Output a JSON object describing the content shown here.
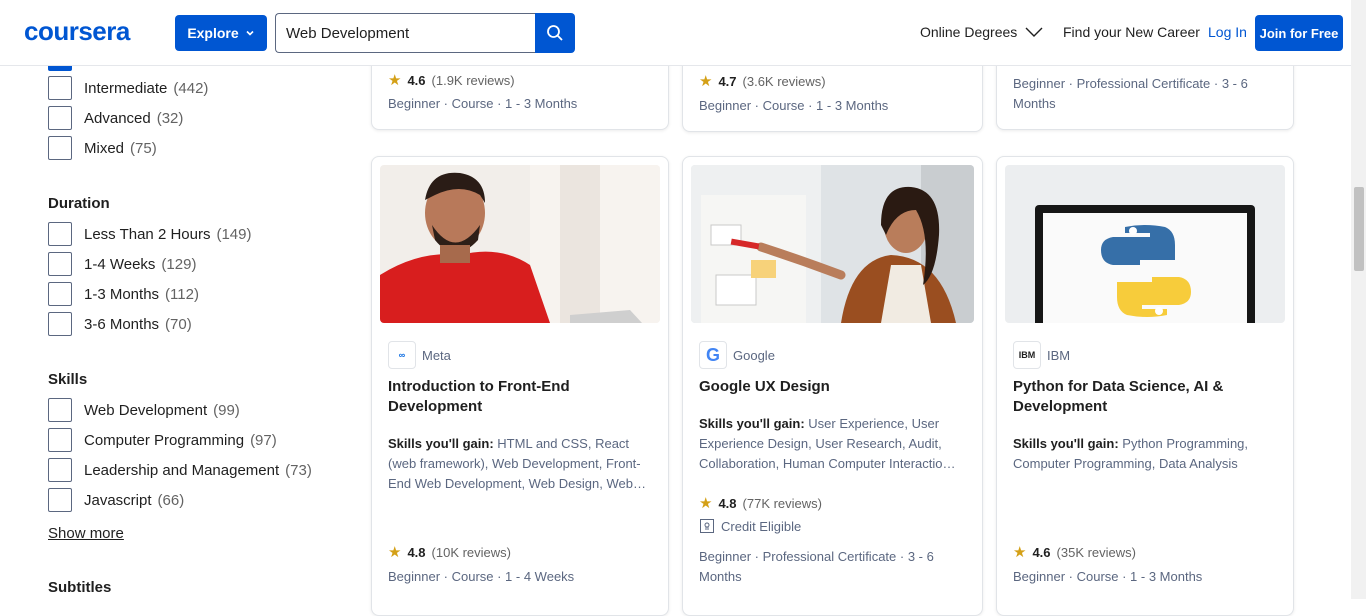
{
  "header": {
    "logo": "coursera",
    "explore_label": "Explore",
    "search_value": "Web Development",
    "nav_online": "Online Degrees",
    "nav_career": "Find your New Career",
    "nav_login": "Log In",
    "join_label": "Join for Free"
  },
  "sidebar": {
    "level_items": [
      {
        "label": "Intermediate",
        "count": "(442)"
      },
      {
        "label": "Advanced",
        "count": "(32)"
      },
      {
        "label": "Mixed",
        "count": "(75)"
      }
    ],
    "duration_heading": "Duration",
    "duration_items": [
      {
        "label": "Less Than 2 Hours",
        "count": "(149)"
      },
      {
        "label": "1-4 Weeks",
        "count": "(129)"
      },
      {
        "label": "1-3 Months",
        "count": "(112)"
      },
      {
        "label": "3-6 Months",
        "count": "(70)"
      }
    ],
    "skills_heading": "Skills",
    "skills_items": [
      {
        "label": "Web Development",
        "count": "(99)"
      },
      {
        "label": "Computer Programming",
        "count": "(97)"
      },
      {
        "label": "Leadership and Management",
        "count": "(73)"
      },
      {
        "label": "Javascript",
        "count": "(66)"
      }
    ],
    "show_more": "Show more",
    "subtitles_heading": "Subtitles"
  },
  "top_cards": [
    {
      "rating": "4.6",
      "reviews": "(1.9K reviews)",
      "meta": "Beginner · Course · 1 - 3 Months"
    },
    {
      "rating": "4.7",
      "reviews": "(3.6K reviews)",
      "meta": "Beginner · Course · 1 - 3 Months"
    },
    {
      "meta": "Beginner · Professional Certificate · 3 - 6 Months"
    }
  ],
  "cards": [
    {
      "partner": "Meta",
      "partner_logo": "Meta",
      "title": "Introduction to Front-End Development",
      "skills_label": "Skills you'll gain:",
      "skills": "HTML and CSS, React (web framework), Web Development, Front-End Web Development, Web Design, Web…",
      "rating": "4.8",
      "reviews": "(10K reviews)",
      "meta": "Beginner · Course · 1 - 4 Weeks"
    },
    {
      "partner": "Google",
      "partner_logo": "G",
      "title": "Google UX Design",
      "skills_label": "Skills you'll gain:",
      "skills": "User Experience, User Experience Design, User Research, Audit, Collaboration, Human Computer Interactio…",
      "rating": "4.8",
      "reviews": "(77K reviews)",
      "credit": "Credit Eligible",
      "meta": "Beginner · Professional Certificate · 3 - 6 Months"
    },
    {
      "partner": "IBM",
      "partner_logo": "IBM",
      "title": "Python for Data Science, AI & Development",
      "skills_label": "Skills you'll gain:",
      "skills": "Python Programming, Computer Programming, Data Analysis",
      "rating": "4.6",
      "reviews": "(35K reviews)",
      "meta": "Beginner · Course · 1 - 3 Months"
    }
  ],
  "colors": {
    "brand": "#0056d2",
    "star": "#d4a017"
  }
}
